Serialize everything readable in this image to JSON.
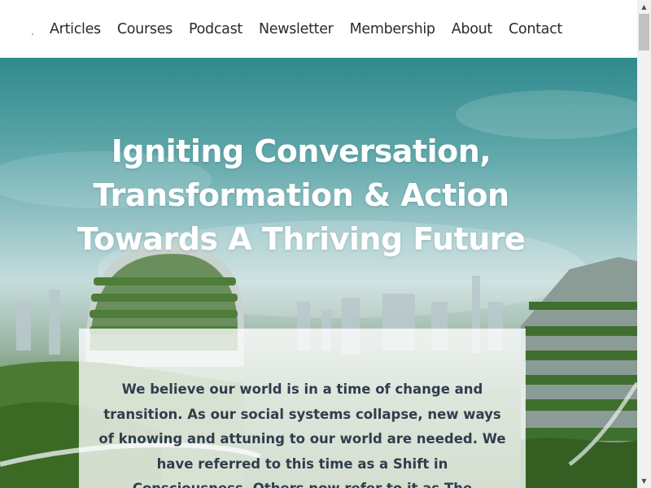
{
  "nav": {
    "items": [
      {
        "label": "Articles"
      },
      {
        "label": "Courses"
      },
      {
        "label": "Podcast"
      },
      {
        "label": "Newsletter"
      },
      {
        "label": "Membership"
      },
      {
        "label": "About"
      },
      {
        "label": "Contact"
      }
    ]
  },
  "hero": {
    "title": "Igniting Conversation, Transformation & Action Towards A Thriving Future",
    "body": "We believe our world is in a time of change and transition. As our social systems collapse, new ways of knowing and attuning to our world are needed. We have referred to this time as a Shift in Consciousness. Others now refer to it as The"
  },
  "colors": {
    "hero_text": "#ffffff",
    "card_text": "#2f3e4e",
    "nav_text": "#2b2b2b"
  },
  "icons": {
    "scroll_up": "triangle-up",
    "scroll_down": "triangle-down"
  }
}
